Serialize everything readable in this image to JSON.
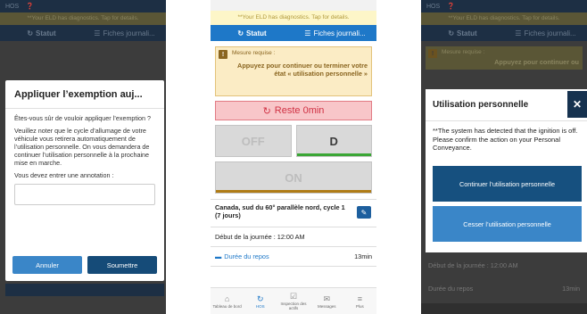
{
  "screen1": {
    "status": {
      "label": "HOS"
    },
    "diagnostics": "**Your ELD has diagnostics. Tap for details.",
    "tabs": [
      {
        "label": "Statut"
      },
      {
        "label": "Fiches journali..."
      }
    ],
    "modal": {
      "title": "Appliquer l’exemption auj...",
      "question": "Êtes-vous sûr de vouloir appliquer l’exemption ?",
      "info": "Veuillez noter que le cycle d’allumage de votre véhicule vous retirera automatiquement de l’utilisation personnelle. On vous demandera de continuer l’utilisation personnelle à la prochaine mise en marche.",
      "annotation_label": "Vous devez entrer une annotation :",
      "annotation_value": "",
      "cancel": "Annuler",
      "submit": "Soumettre"
    }
  },
  "screen2": {
    "diagnostics": "**Your ELD has diagnostics. Tap for details.",
    "tabs": [
      {
        "label": "Statut"
      },
      {
        "label": "Fiches journali..."
      }
    ],
    "alert": {
      "title": "Mesure requise :",
      "text": "Appuyez pour continuer ou terminer votre état « utilisation personnelle »"
    },
    "remaining": "Reste 0min",
    "duty": {
      "off": "OFF",
      "d": "D",
      "on": "ON"
    },
    "rule": "Canada, sud du 60° parallèle nord, cycle 1 (7 jours)",
    "day_start": "Début de la journée : 12:00 AM",
    "rest": {
      "label": "Durée du repos",
      "value": "13min"
    },
    "nav": [
      {
        "label": "Tableau de bord",
        "icon": "home-icon"
      },
      {
        "label": "HOS",
        "icon": "clock-icon"
      },
      {
        "label": "Inspection des actifs",
        "icon": "inspection-icon"
      },
      {
        "label": "Messages",
        "icon": "mail-icon"
      },
      {
        "label": "Plus",
        "icon": "menu-icon"
      }
    ]
  },
  "screen3": {
    "status": {
      "label": "HOS"
    },
    "diagnostics": "**Your ELD has diagnostics. Tap for details.",
    "tabs": [
      {
        "label": "Statut"
      },
      {
        "label": "Fiches journali..."
      }
    ],
    "alert": {
      "title": "Mesure requise :",
      "text": "Appuyez pour continuer ou"
    },
    "modal": {
      "title": "Utilisation personnelle",
      "text": "**The system has detected that the ignition is off. Please confirm the action on your Personal Conveyance.",
      "continue": "Continuer l’utilisation personnelle",
      "stop": "Cesser l’utilisation personnelle"
    },
    "day_start": "Début de la journée : 12:00 AM",
    "rest": {
      "label": "Durée du repos",
      "value": "13min"
    }
  },
  "colors": {
    "primary_blue": "#1e78c8",
    "dark_blue": "#16507f",
    "alert_red": "#d03244",
    "driving_green": "#3aa635",
    "on_duty_brown": "#b07c16",
    "warning_bg": "#fbecc5"
  }
}
